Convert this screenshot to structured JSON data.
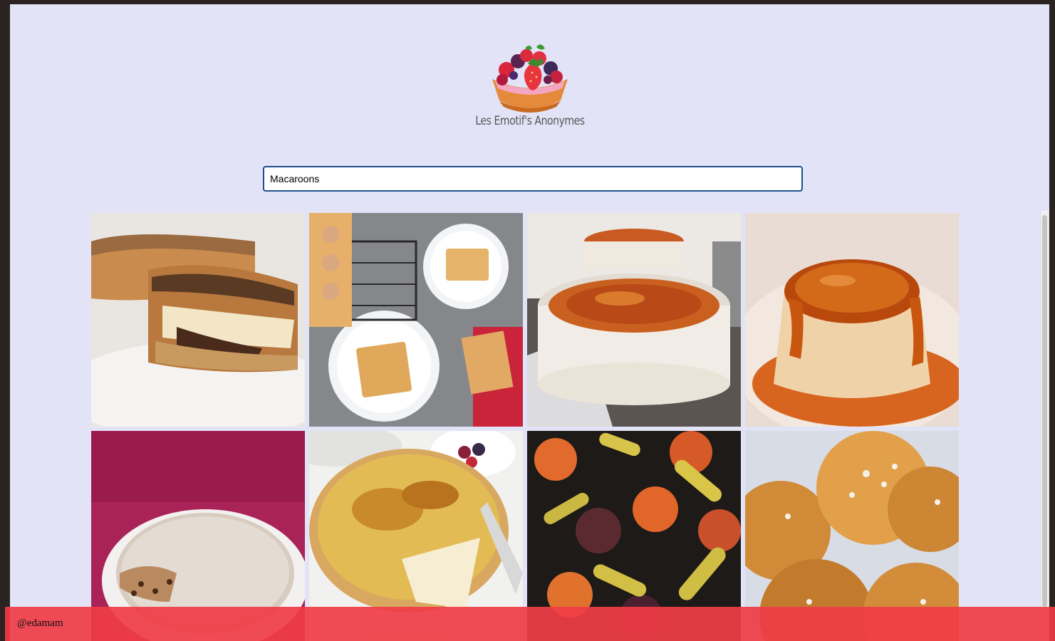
{
  "brand": {
    "name": "Les Emotif's Anonymes",
    "logo_icon": "fruit-tart-icon"
  },
  "search": {
    "value": "Macaroons",
    "placeholder": ""
  },
  "recipes": [
    {
      "id": "recipe-1",
      "image": "grilled-cheese-sandwich"
    },
    {
      "id": "recipe-2",
      "image": "apple-tarts"
    },
    {
      "id": "recipe-3",
      "image": "creme-brulee"
    },
    {
      "id": "recipe-4",
      "image": "caramel-flan"
    },
    {
      "id": "recipe-5",
      "image": "sugar-dusted-tart"
    },
    {
      "id": "recipe-6",
      "image": "brulee-tart"
    },
    {
      "id": "recipe-7",
      "image": "grilled-fruit"
    },
    {
      "id": "recipe-8",
      "image": "chouquettes"
    }
  ],
  "footer": {
    "credit": "@edamam"
  },
  "colors": {
    "page_background": "#e3e3f7",
    "footer_background": "#f03c46",
    "search_border": "#1f4e8c"
  }
}
